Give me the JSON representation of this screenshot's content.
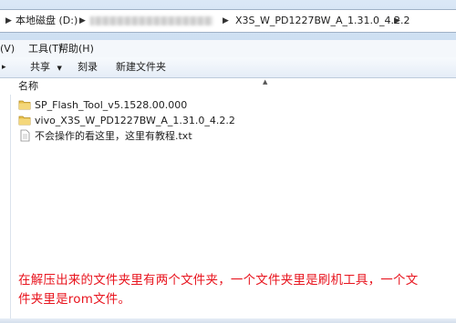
{
  "address": {
    "drive": "本地磁盘 (D:)",
    "folder": "X3S_W_PD1227BW_A_1.31.0_4.2.2"
  },
  "menu": {
    "items": [
      "(V)",
      "工具(T)",
      "帮助(H)"
    ]
  },
  "toolbar": {
    "share": "共享",
    "burn": "刻录",
    "new_folder": "新建文件夹"
  },
  "columns": {
    "name": "名称"
  },
  "files": [
    {
      "name": "SP_Flash_Tool_v5.1528.00.000",
      "type": "folder",
      "icon": "folder-icon"
    },
    {
      "name": "vivo_X3S_W_PD1227BW_A_1.31.0_4.2.2",
      "type": "folder",
      "icon": "folder-icon"
    },
    {
      "name": "不会操作的看这里，这里有教程.txt",
      "type": "text",
      "icon": "text-file-icon"
    }
  ],
  "annotation": {
    "line1": "在解压出来的文件夹里有两个文件夹，一个文件夹里是刷机工具，一个文",
    "line2": "件夹里是rom文件。"
  },
  "colors": {
    "annotation": "#e8141e",
    "folder": "#e8c04c"
  }
}
